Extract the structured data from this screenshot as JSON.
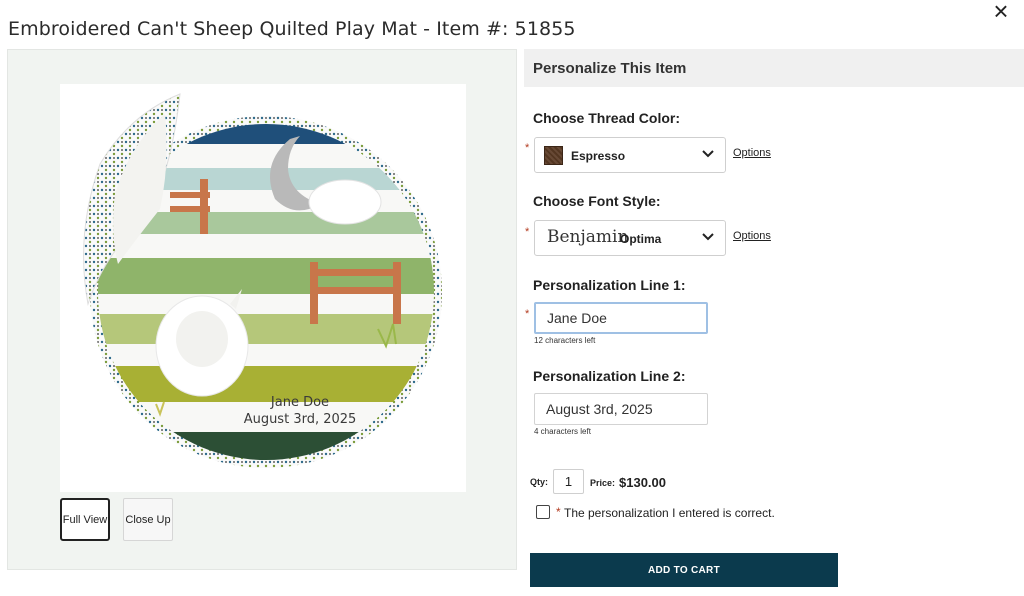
{
  "title": "Embroidered Can't Sheep Quilted Play Mat - Item #: 51855",
  "close_icon": "close-icon",
  "product": {
    "embroidery_line1": "Jane Doe",
    "embroidery_line2": "August 3rd, 2025",
    "thumbnails": [
      {
        "label": "Full View",
        "selected": true
      },
      {
        "label": "Close Up",
        "selected": false
      }
    ]
  },
  "personalize": {
    "header": "Personalize This Item",
    "thread": {
      "label": "Choose Thread Color:",
      "value": "Espresso",
      "swatch_color": "#5a3a24",
      "options_link": "Options"
    },
    "font": {
      "label": "Choose Font Style:",
      "sample": "Benjamin",
      "value": "Optima",
      "options_link": "Options"
    },
    "line1": {
      "label": "Personalization Line 1:",
      "value": "Jane Doe",
      "chars_left": "12 characters left"
    },
    "line2": {
      "label": "Personalization Line 2:",
      "value": "August 3rd, 2025",
      "chars_left": "4 characters left"
    },
    "required_mark": "*",
    "qty_label": "Qty:",
    "qty": "1",
    "price_label": "Price:",
    "price": "$130.00",
    "confirm_text": "The personalization I entered is correct.",
    "add_to_cart": "ADD TO CART"
  },
  "colors": {
    "accent": "#0b3a4d",
    "required": "#b23a1f"
  }
}
